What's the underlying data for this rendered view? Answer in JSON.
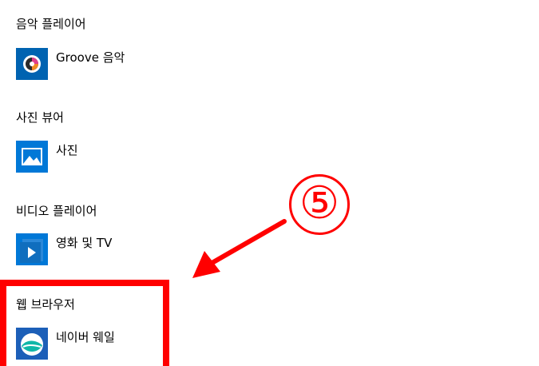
{
  "sections": [
    {
      "title": "음악 플레이어",
      "app": {
        "label": "Groove 음악",
        "icon": "groove-music-icon"
      }
    },
    {
      "title": "사진 뷰어",
      "app": {
        "label": "사진",
        "icon": "photos-icon"
      }
    },
    {
      "title": "비디오 플레이어",
      "app": {
        "label": "영화 및 TV",
        "icon": "movies-tv-icon"
      }
    },
    {
      "title": "웹 브라우저",
      "app": {
        "label": "네이버 웨일",
        "icon": "naver-whale-icon"
      }
    }
  ],
  "annotation": {
    "number": "⑤",
    "color": "#ff0000"
  },
  "colors": {
    "tile_blue": "#0078d7",
    "accent_red": "#ff0000"
  }
}
